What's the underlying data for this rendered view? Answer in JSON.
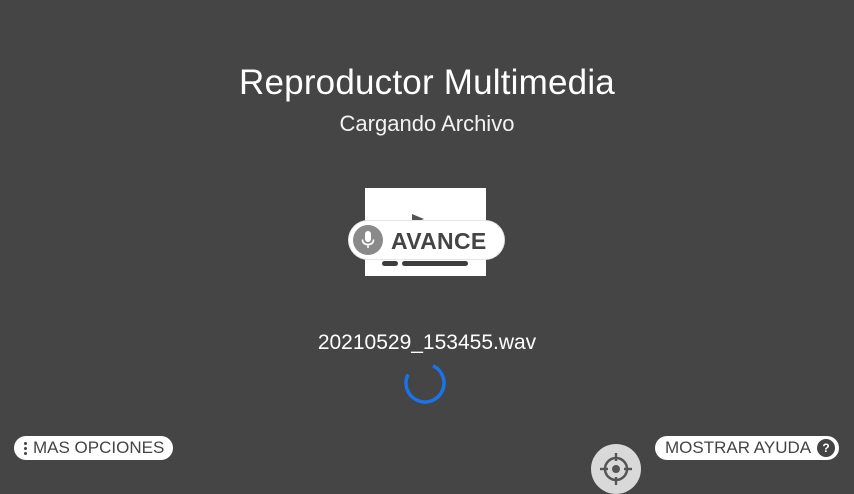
{
  "header": {
    "title": "Reproductor Multimedia",
    "subtitle": "Cargando Archivo"
  },
  "preview": {
    "badge_label": "AVANCE",
    "badge_icon": "microphone-icon",
    "thumbnail_icon": "play-icon"
  },
  "file": {
    "name": "20210529_153455.wav"
  },
  "loading": {
    "spinner_color": "#1a73e8"
  },
  "footer": {
    "more_options_label": "MAS OPCIONES",
    "more_options_icon": "more-vertical-icon",
    "help_label": "MOSTRAR AYUDA",
    "help_icon_text": "?",
    "target_icon": "crosshair-icon"
  },
  "colors": {
    "background": "#454545",
    "pill": "#ffffff",
    "pill_text": "#444444"
  }
}
